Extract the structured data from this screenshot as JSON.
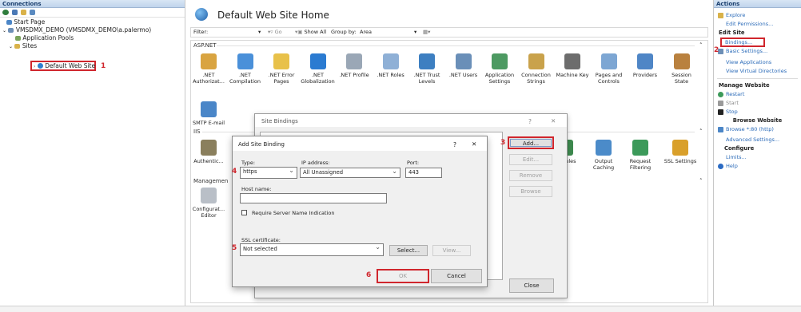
{
  "connections": {
    "title": "Connections",
    "tree": [
      {
        "label": "Start Page"
      },
      {
        "label": "VMSDMX_DEMO (VMSDMX_DEMO\\a.palermo)"
      },
      {
        "label": "Application Pools"
      },
      {
        "label": "Sites"
      },
      {
        "label": "Default Web Site"
      }
    ]
  },
  "center": {
    "title": "Default Web Site Home",
    "filter_label": "Filter:",
    "go_label": "Go",
    "show_all_label": "Show All",
    "group_by_label": "Group by:",
    "group_by_value": "Area",
    "section_aspnet": "ASP.NET",
    "section_iis": "IIS",
    "section_management": "Managemen",
    "aspnet_features": [
      {
        "label": ".NET Authorizat...",
        "color": "#d9a441"
      },
      {
        "label": ".NET Compilation",
        "color": "#4a90d9"
      },
      {
        "label": ".NET Error Pages",
        "color": "#e8c14a"
      },
      {
        "label": ".NET Globalization",
        "color": "#2b7bd1"
      },
      {
        "label": ".NET Profile",
        "color": "#9aa7b6"
      },
      {
        "label": ".NET Roles",
        "color": "#8fb0d6"
      },
      {
        "label": ".NET Trust Levels",
        "color": "#3d7fc1"
      },
      {
        "label": ".NET Users",
        "color": "#6a8fb8"
      },
      {
        "label": "Application Settings",
        "color": "#4d9a62"
      },
      {
        "label": "Connection Strings",
        "color": "#c9a24b"
      },
      {
        "label": "Machine Key",
        "color": "#6d6d6d"
      },
      {
        "label": "Pages and Controls",
        "color": "#7da6d3"
      },
      {
        "label": "Providers",
        "color": "#4f86c6"
      },
      {
        "label": "Session State",
        "color": "#b9813f"
      }
    ],
    "smtp_label": "SMTP E-mail",
    "iis_features": [
      {
        "label": "Authentic...",
        "color": "#8a7f5d"
      },
      {
        "label": "Modules",
        "color": "#3e8a4f"
      },
      {
        "label": "Output Caching",
        "color": "#4b8bc9"
      },
      {
        "label": "Request Filtering",
        "color": "#3c9a5a"
      },
      {
        "label": "SSL Settings",
        "color": "#d9a02b"
      }
    ],
    "mgmt_feature": "Configurat... Editor"
  },
  "site_bindings": {
    "title": "Site Bindings",
    "help": "?",
    "close": "✕",
    "add_label": "Add...",
    "edit_label": "Edit...",
    "remove_label": "Remove",
    "browse_label": "Browse",
    "close_label": "Close"
  },
  "add_binding": {
    "title": "Add Site Binding",
    "help": "?",
    "close": "✕",
    "type_label": "Type:",
    "type_value": "https",
    "ip_label": "IP address:",
    "ip_value": "All Unassigned",
    "port_label": "Port:",
    "port_value": "443",
    "host_label": "Host name:",
    "host_value": "",
    "sni_label": "Require Server Name Indication",
    "ssl_label": "SSL certificate:",
    "ssl_value": "Not selected",
    "select_label": "Select...",
    "view_label": "View...",
    "ok_label": "OK",
    "cancel_label": "Cancel"
  },
  "actions": {
    "title": "Actions",
    "explore": "Explore",
    "edit_permissions": "Edit Permissions...",
    "edit_site": "Edit Site",
    "bindings": "Bindings...",
    "basic_settings": "Basic Settings...",
    "view_applications": "View Applications",
    "view_virtual_dirs": "View Virtual Directories",
    "manage_website": "Manage Website",
    "restart": "Restart",
    "start": "Start",
    "stop": "Stop",
    "browse_website": "Browse Website",
    "browse_80": "Browse *:80 (http)",
    "advanced_settings": "Advanced Settings...",
    "configure": "Configure",
    "limits": "Limits...",
    "help": "Help"
  },
  "markers": [
    "1",
    "2",
    "3",
    "4",
    "5",
    "6"
  ],
  "colors": {
    "marker_red": "#d0262d",
    "link_blue": "#2a6ab8",
    "header_blue": "#1b3f6e"
  }
}
